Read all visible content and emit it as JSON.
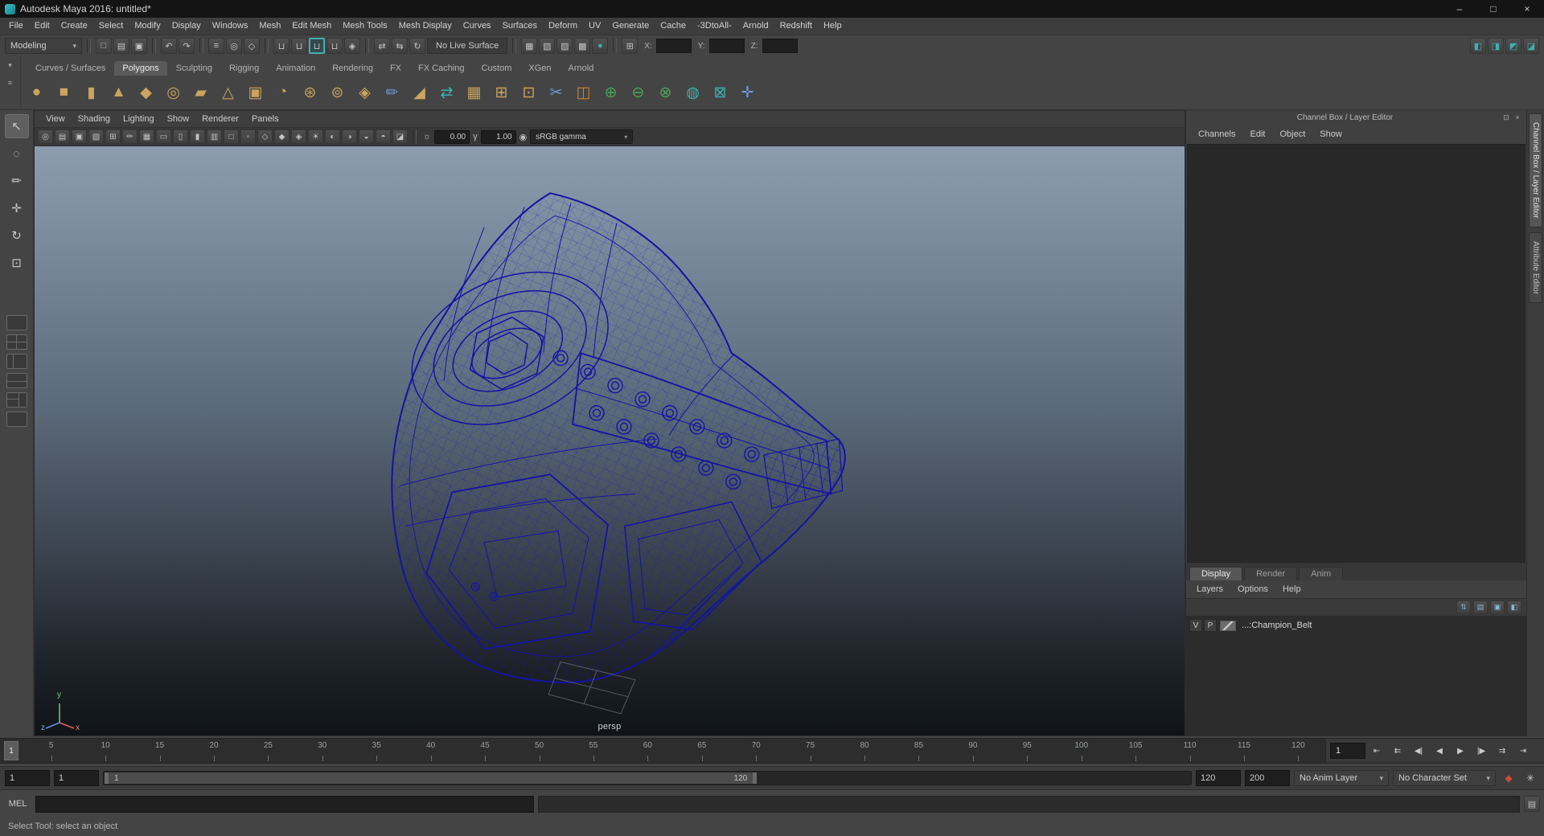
{
  "window": {
    "title": "Autodesk Maya 2016: untitled*",
    "minimize_glyph": "–",
    "maximize_glyph": "□",
    "close_glyph": "×"
  },
  "menu_bar": {
    "items": [
      "File",
      "Edit",
      "Create",
      "Select",
      "Modify",
      "Display",
      "Windows",
      "Mesh",
      "Edit Mesh",
      "Mesh Tools",
      "Mesh Display",
      "Curves",
      "Surfaces",
      "Deform",
      "UV",
      "Generate",
      "Cache",
      "-3DtoAll-",
      "Arnold",
      "Redshift",
      "Help"
    ]
  },
  "status_line": {
    "menuset": "Modeling",
    "dropdown_arrow": "▾",
    "file_icons": [
      {
        "name": "new-scene-icon",
        "glyph": "□"
      },
      {
        "name": "open-scene-icon",
        "glyph": "▤"
      },
      {
        "name": "save-scene-icon",
        "glyph": "▣"
      }
    ],
    "undo_icons": [
      {
        "name": "undo-icon",
        "glyph": "↶"
      },
      {
        "name": "redo-icon",
        "glyph": "↷"
      }
    ],
    "selection_icons": [
      {
        "name": "select-by-hierarchy-icon",
        "glyph": "≡"
      },
      {
        "name": "select-by-object-icon",
        "glyph": "◎"
      },
      {
        "name": "select-by-component-icon",
        "glyph": "◇"
      }
    ],
    "snap_icons": [
      {
        "name": "snap-to-grids-icon",
        "glyph": "⊔"
      },
      {
        "name": "snap-to-curves-icon",
        "glyph": "⊔"
      },
      {
        "name": "snap-to-points-icon",
        "glyph": "⊔",
        "cls": "active"
      },
      {
        "name": "snap-to-view-planes-icon",
        "glyph": "⊔"
      },
      {
        "name": "make-object-live-icon",
        "glyph": "◈"
      }
    ],
    "history_icons": [
      {
        "name": "inputs-to-selected-icon",
        "glyph": "⇄"
      },
      {
        "name": "outputs-from-selected-icon",
        "glyph": "⇆"
      },
      {
        "name": "construction-history-icon",
        "glyph": "↻"
      }
    ],
    "live_surface": "No Live Surface",
    "render_icons": [
      {
        "name": "open-render-view-icon",
        "glyph": "▦"
      },
      {
        "name": "render-current-frame-icon",
        "glyph": "▧"
      },
      {
        "name": "ipr-render-icon",
        "glyph": "▨"
      },
      {
        "name": "render-settings-icon",
        "glyph": "▩"
      },
      {
        "name": "hypershade-icon",
        "glyph": "●",
        "cls": "teal"
      }
    ],
    "coord": {
      "selector_glyph": "⊞",
      "x_label": "X:",
      "x_value": "",
      "y_label": "Y:",
      "y_value": "",
      "z_label": "Z:",
      "z_value": ""
    },
    "panel_toggle_icons": [
      {
        "name": "toggle-modeling-toolkit-icon",
        "glyph": "◧"
      },
      {
        "name": "toggle-attribute-editor-icon",
        "glyph": "◨"
      },
      {
        "name": "toggle-tool-settings-icon",
        "glyph": "◩"
      },
      {
        "name": "toggle-channel-box-icon",
        "glyph": "◪"
      }
    ]
  },
  "shelf": {
    "selector_icons": [
      {
        "name": "shelf-tab-selector-icon",
        "glyph": "▾"
      },
      {
        "name": "shelf-menu-icon",
        "glyph": "≡"
      }
    ],
    "tabs": [
      {
        "label": "Curves / Surfaces"
      },
      {
        "label": "Polygons",
        "cls": "active"
      },
      {
        "label": "Sculpting"
      },
      {
        "label": "Rigging"
      },
      {
        "label": "Animation"
      },
      {
        "label": "Rendering"
      },
      {
        "label": "FX"
      },
      {
        "label": "FX Caching"
      },
      {
        "label": "Custom"
      },
      {
        "label": "XGen"
      },
      {
        "label": "Arnold"
      }
    ],
    "items": [
      {
        "name": "poly-sphere-icon",
        "glyph": "●",
        "cls": "gold"
      },
      {
        "name": "poly-cube-icon",
        "glyph": "■",
        "cls": "gold"
      },
      {
        "name": "poly-cylinder-icon",
        "glyph": "▮",
        "cls": "gold"
      },
      {
        "name": "poly-cone-icon",
        "glyph": "▲",
        "cls": "gold"
      },
      {
        "name": "poly-plane-icon",
        "glyph": "◆",
        "cls": "gold"
      },
      {
        "name": "poly-torus-icon",
        "glyph": "◎",
        "cls": "gold"
      },
      {
        "name": "poly-prism-icon",
        "glyph": "▰",
        "cls": "gold"
      },
      {
        "name": "poly-pyramid-icon",
        "glyph": "△",
        "cls": "gold"
      },
      {
        "name": "poly-pipe-icon",
        "glyph": "▣",
        "cls": "gold"
      },
      {
        "name": "poly-helix-icon",
        "glyph": "◔",
        "cls": "gold"
      },
      {
        "name": "poly-gear-icon",
        "glyph": "⊛",
        "cls": "gold"
      },
      {
        "name": "poly-soccer-ball-icon",
        "glyph": "⊚",
        "cls": "gold"
      },
      {
        "name": "poly-platonic-solid-icon",
        "glyph": "◈",
        "cls": "gold"
      },
      {
        "name": "sculpt-tool-icon",
        "glyph": "✏",
        "cls": "blue"
      },
      {
        "name": "poly-wedge-icon",
        "glyph": "◢",
        "cls": "gold"
      },
      {
        "name": "quad-draw-icon",
        "glyph": "⇄",
        "cls": "teal"
      },
      {
        "name": "poly-combine-icon",
        "glyph": "▦",
        "cls": "gold"
      },
      {
        "name": "poly-extrude-icon",
        "glyph": "⊞",
        "cls": "gold"
      },
      {
        "name": "poly-bevel-icon",
        "glyph": "⊡",
        "cls": "gold"
      },
      {
        "name": "multi-cut-icon",
        "glyph": "✂",
        "cls": "blue"
      },
      {
        "name": "poly-mirror-icon",
        "glyph": "◫",
        "cls": "orange"
      },
      {
        "name": "boolean-union-icon",
        "glyph": "⊕",
        "cls": "green"
      },
      {
        "name": "boolean-difference-icon",
        "glyph": "⊖",
        "cls": "green"
      },
      {
        "name": "boolean-intersection-icon",
        "glyph": "⊗",
        "cls": "green"
      },
      {
        "name": "smooth-icon",
        "glyph": "◍",
        "cls": "teal"
      },
      {
        "name": "remesh-icon",
        "glyph": "⊠",
        "cls": "teal"
      },
      {
        "name": "modeling-toolkit-icon",
        "glyph": "✛",
        "cls": "blue"
      }
    ]
  },
  "toolbox": {
    "tools": [
      {
        "name": "select-tool-icon",
        "glyph": "↖",
        "cls": "active"
      },
      {
        "name": "lasso-tool-icon",
        "glyph": "◌"
      },
      {
        "name": "paint-selection-tool-icon",
        "glyph": "✏"
      },
      {
        "name": "move-tool-icon",
        "glyph": "✛"
      },
      {
        "name": "rotate-tool-icon",
        "glyph": "↻"
      },
      {
        "name": "scale-tool-icon",
        "glyph": "⊡"
      }
    ],
    "layouts": [
      {
        "name": "layout-single-pane-icon",
        "cls": "lay1"
      },
      {
        "name": "layout-four-pane-icon",
        "cls": "lay4"
      },
      {
        "name": "layout-persp-outliner-icon",
        "cls": "lay2v"
      },
      {
        "name": "layout-persp-graph-icon",
        "cls": "lay2h"
      },
      {
        "name": "layout-hypershade-persp-icon",
        "cls": "lay2t"
      },
      {
        "name": "layout-custom-icon",
        "cls": "lay1"
      }
    ]
  },
  "viewport": {
    "menus": [
      "View",
      "Shading",
      "Lighting",
      "Show",
      "Renderer",
      "Panels"
    ],
    "toolbar_icons": [
      {
        "name": "lock-camera-icon",
        "glyph": "◎"
      },
      {
        "name": "camera-attributes-icon",
        "glyph": "▤"
      },
      {
        "name": "bookmark-icon",
        "glyph": "▣"
      },
      {
        "name": "image-plane-icon",
        "glyph": "▧"
      },
      {
        "name": "two-d-pan-zoom-icon",
        "glyph": "⊞"
      },
      {
        "name": "grease-pencil-icon",
        "glyph": "✏"
      },
      {
        "name": "grid-toggle-icon",
        "glyph": "▦"
      },
      {
        "name": "film-gate-icon",
        "glyph": "▭"
      },
      {
        "name": "resolution-gate-icon",
        "glyph": "▯"
      },
      {
        "name": "gate-mask-icon",
        "glyph": "▮"
      },
      {
        "name": "field-chart-icon",
        "glyph": "▥"
      },
      {
        "name": "safe-action-icon",
        "glyph": "□"
      },
      {
        "name": "safe-title-icon",
        "glyph": "▫"
      },
      {
        "name": "wireframe-mode-icon",
        "glyph": "◇"
      },
      {
        "name": "shaded-mode-icon",
        "glyph": "◆"
      },
      {
        "name": "textured-mode-icon",
        "glyph": "◈"
      },
      {
        "name": "use-all-lights-icon",
        "glyph": "☀"
      },
      {
        "name": "shadows-icon",
        "glyph": "◐"
      },
      {
        "name": "ambient-occlusion-icon",
        "glyph": "◑"
      },
      {
        "name": "motion-blur-icon",
        "glyph": "◒"
      },
      {
        "name": "xray-icon",
        "glyph": "◓"
      },
      {
        "name": "isolate-select-icon",
        "glyph": "◪"
      }
    ],
    "exposure_icon_glyph": "☼",
    "exposure": "0.00",
    "gamma_symbol": "γ",
    "gamma": "1.00",
    "color_mgmt_glyph": "◉",
    "color_space": "sRGB gamma",
    "dropdown_arrow": "▾",
    "camera_label": "persp",
    "axis": {
      "x": "x",
      "y": "y",
      "z": "z"
    }
  },
  "channel_box": {
    "title": "Channel Box / Layer Editor",
    "header_icons": [
      {
        "name": "dock-panel-icon",
        "glyph": "⊡"
      },
      {
        "name": "close-panel-icon",
        "glyph": "×"
      }
    ],
    "menus": [
      "Channels",
      "Edit",
      "Object",
      "Show"
    ],
    "layer_editor": {
      "tabs": [
        {
          "label": "Display",
          "cls": "active"
        },
        {
          "label": "Render"
        },
        {
          "label": "Anim"
        }
      ],
      "menus": [
        "Layers",
        "Options",
        "Help"
      ],
      "toolbar_icons": [
        {
          "name": "sort-layers-icon",
          "glyph": "⇅"
        },
        {
          "name": "new-empty-layer-icon",
          "glyph": "▤"
        },
        {
          "name": "new-layer-from-selected-icon",
          "glyph": "▣"
        },
        {
          "name": "layer-options-icon",
          "glyph": "◧"
        }
      ],
      "layers": [
        {
          "visible": "V",
          "playback": "P",
          "name_text": "...:Champion_Belt"
        }
      ]
    }
  },
  "right_dock": {
    "tabs": [
      "Channel Box / Layer Editor",
      "Attribute Editor"
    ]
  },
  "time_slider": {
    "current_frame": "1",
    "ticks": [
      "5",
      "10",
      "15",
      "20",
      "25",
      "30",
      "35",
      "40",
      "45",
      "50",
      "55",
      "60",
      "65",
      "70",
      "75",
      "80",
      "85",
      "90",
      "95",
      "100",
      "105",
      "110",
      "115",
      "120"
    ],
    "frame_field": "1",
    "playback_icons": [
      {
        "name": "go-to-start-icon",
        "glyph": "⇤"
      },
      {
        "name": "step-back-frame-icon",
        "glyph": "⇇"
      },
      {
        "name": "step-back-key-icon",
        "glyph": "◀|"
      },
      {
        "name": "play-backwards-icon",
        "glyph": "◀"
      },
      {
        "name": "play-forwards-icon",
        "glyph": "▶"
      },
      {
        "name": "step-forward-key-icon",
        "glyph": "|▶"
      },
      {
        "name": "step-forward-frame-icon",
        "glyph": "⇉"
      },
      {
        "name": "go-to-end-icon",
        "glyph": "⇥"
      }
    ]
  },
  "range_slider": {
    "playback_start": "1",
    "animation_start": "1",
    "bar_start_label": "1",
    "bar_end_label": "120",
    "playback_end": "120",
    "animation_end": "200",
    "anim_layer": "No Anim Layer",
    "character_set": "No Character Set",
    "dropdown_arrow": "▾",
    "icons": [
      {
        "name": "auto-keyframe-icon",
        "glyph": "◆",
        "cls": "red"
      },
      {
        "name": "animation-preferences-icon",
        "glyph": "✳"
      }
    ]
  },
  "command_line": {
    "mode_label": "MEL",
    "input_value": "",
    "icons": [
      {
        "name": "script-editor-icon",
        "glyph": "▤"
      }
    ]
  },
  "help_line": {
    "text": "Select Tool: select an object"
  },
  "colors": {
    "wireframe": "#1414a2",
    "viewport_top": "#8b9cae",
    "viewport_bottom": "#101418",
    "accent_teal": "#3fb0b0"
  }
}
